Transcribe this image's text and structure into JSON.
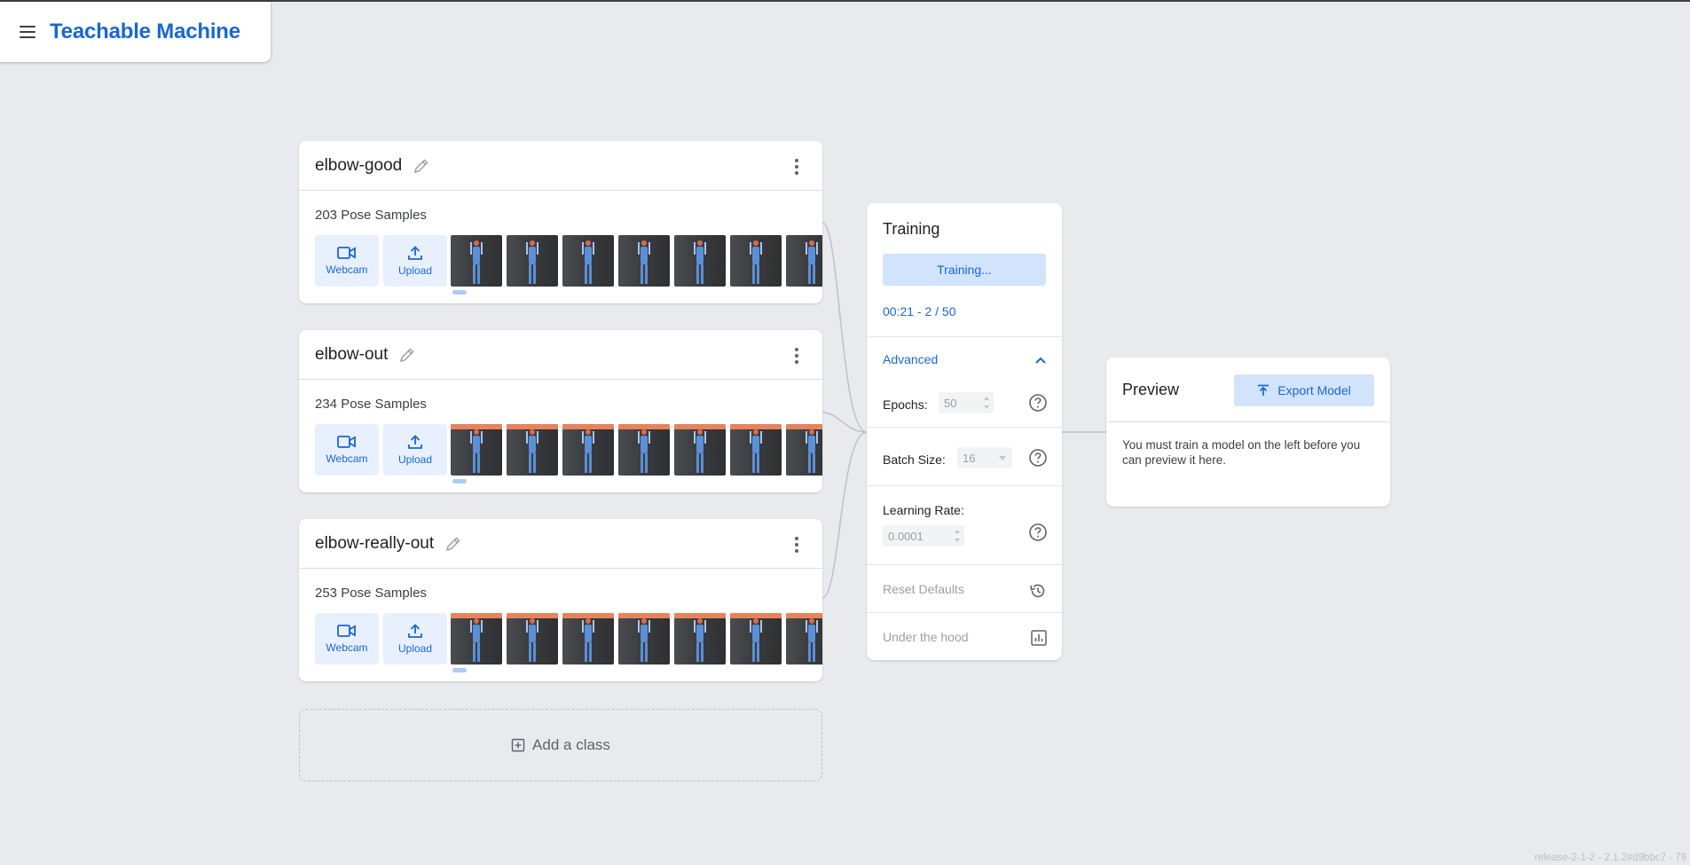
{
  "app": {
    "title": "Teachable Machine",
    "menu_icon": "hamburger-menu-icon"
  },
  "classes": [
    {
      "name": "elbow-good",
      "samples": "203 Pose Samples",
      "webcam_label": "Webcam",
      "upload_label": "Upload"
    },
    {
      "name": "elbow-out",
      "samples": "234 Pose Samples",
      "webcam_label": "Webcam",
      "upload_label": "Upload"
    },
    {
      "name": "elbow-really-out",
      "samples": "253 Pose Samples",
      "webcam_label": "Webcam",
      "upload_label": "Upload"
    }
  ],
  "add_class": {
    "label": "Add a class"
  },
  "training": {
    "title": "Training",
    "button_label": "Training...",
    "progress": "00:21 - 2 / 50",
    "advanced_label": "Advanced",
    "epochs_label": "Epochs:",
    "epochs_value": "50",
    "batch_label": "Batch Size:",
    "batch_value": "16",
    "lr_label": "Learning Rate:",
    "lr_value": "0.0001",
    "reset_label": "Reset Defaults",
    "hood_label": "Under the hood"
  },
  "preview": {
    "title": "Preview",
    "export_label": "Export Model",
    "message": "You must train a model on the left before you can preview it here."
  },
  "footer": {
    "version": "release-2-1-2 - 2.1.2#d9bbc7 - 79"
  },
  "colors": {
    "accent": "#1967d2",
    "accent_bg": "#d2e3fc",
    "page_bg": "#e8eaed"
  }
}
